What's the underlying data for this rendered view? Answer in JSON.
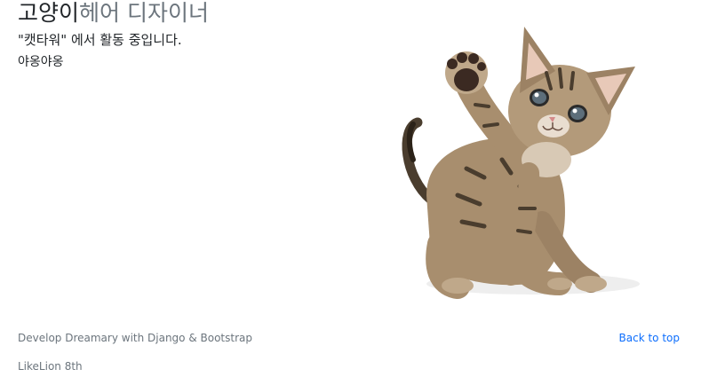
{
  "hero": {
    "title_strong": "고양이",
    "title_muted": "헤어 디자이너",
    "lead": "\"캣타워\" 에서 활동 중입니다.",
    "sub": "야옹야옹"
  },
  "image": {
    "subject": "kitten-waving"
  },
  "footer": {
    "credit": "Develop Dreamary with Django & Bootstrap",
    "team": "LikeLion 8th",
    "back_to_top": "Back to top"
  },
  "colors": {
    "link": "#0d6efd",
    "muted": "#6c757d",
    "text": "#212529"
  }
}
